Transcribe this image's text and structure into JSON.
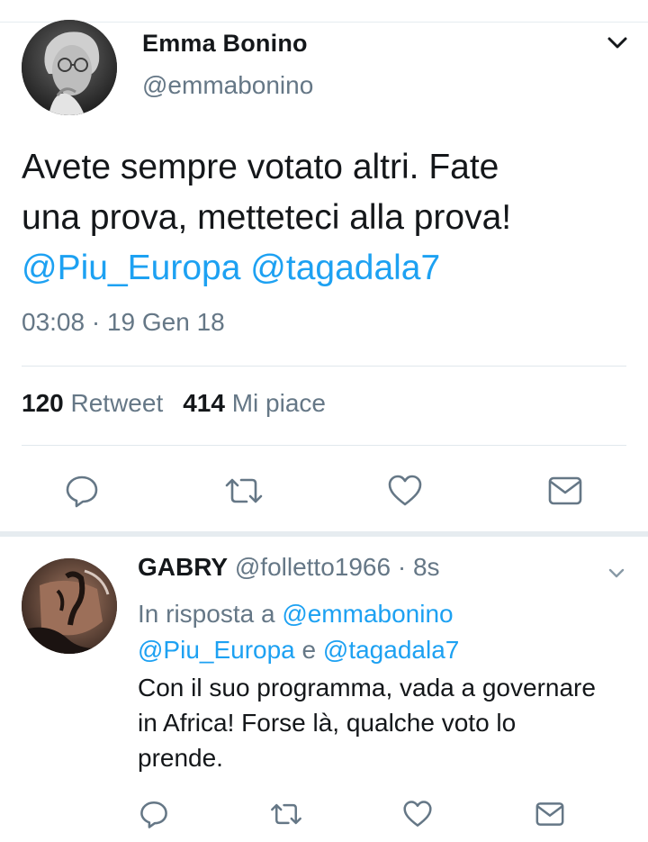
{
  "main_tweet": {
    "author_name": "Emma Bonino",
    "author_handle": "@emmabonino",
    "text_line1": "Avete sempre votato altri. Fate",
    "text_line2": "una prova, metteteci alla prova!",
    "mention1": "@Piu_Europa",
    "mention2": "@tagadala7",
    "timestamp": "03:08 · 19 Gen 18",
    "retweet_count": "120",
    "retweet_label": "Retweet",
    "like_count": "414",
    "like_label": "Mi piace"
  },
  "reply_tweet": {
    "author_name": "GABRY",
    "author_handle": "@folletto1966",
    "time_ago": "· 8s",
    "reply_prefix": "In risposta a",
    "reply_mention1": "@emmabonino",
    "reply_mention2": "@Piu_Europa",
    "reply_conjunction": "e",
    "reply_mention3": "@tagadala7",
    "text_line1": "Con il suo programma, vada a governare",
    "text_line2": "in Africa! Forse là, qualche voto lo",
    "text_line3": "prende."
  },
  "icons": {
    "reply": "reply-icon",
    "retweet": "retweet-icon",
    "like": "heart-icon",
    "dm": "mail-icon",
    "menu": "chevron-down-icon"
  },
  "colors": {
    "link": "#1da1f2",
    "secondary_text": "#657786",
    "primary_text": "#14171a",
    "divider": "#e6ecf0"
  }
}
